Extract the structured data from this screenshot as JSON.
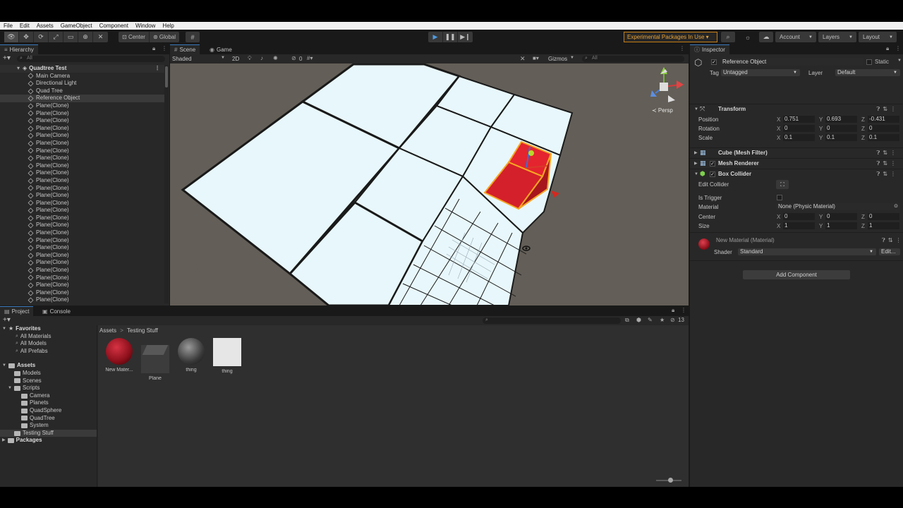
{
  "menu": [
    "File",
    "Edit",
    "Assets",
    "GameObject",
    "Component",
    "Window",
    "Help"
  ],
  "toolbar": {
    "pivot": "Center",
    "space": "Global",
    "experimental": "Experimental Packages In Use ▾",
    "account": "Account",
    "layers": "Layers",
    "layout": "Layout"
  },
  "hierarchy": {
    "tab": "Hierarchy",
    "search_placeholder": "All",
    "root": "Quadtree Test",
    "items": [
      "Main Camera",
      "Directional Light",
      "Quad Tree",
      "Reference Object",
      "Plane(Clone)",
      "Plane(Clone)",
      "Plane(Clone)",
      "Plane(Clone)",
      "Plane(Clone)",
      "Plane(Clone)",
      "Plane(Clone)",
      "Plane(Clone)",
      "Plane(Clone)",
      "Plane(Clone)",
      "Plane(Clone)",
      "Plane(Clone)",
      "Plane(Clone)",
      "Plane(Clone)",
      "Plane(Clone)",
      "Plane(Clone)",
      "Plane(Clone)",
      "Plane(Clone)",
      "Plane(Clone)",
      "Plane(Clone)",
      "Plane(Clone)",
      "Plane(Clone)",
      "Plane(Clone)",
      "Plane(Clone)",
      "Plane(Clone)",
      "Plane(Clone)",
      "Plane(Clone)"
    ],
    "selected_index": 3
  },
  "scene": {
    "tabs": [
      "Scene",
      "Game"
    ],
    "shading": "Shaded",
    "mode_2d": "2D",
    "hidden_count": "0",
    "gizmos": "Gizmos",
    "search_placeholder": "All",
    "projection": "≺ Persp"
  },
  "inspector": {
    "tab": "Inspector",
    "object_name": "Reference Object",
    "static_label": "Static",
    "tag_label": "Tag",
    "tag_value": "Untagged",
    "layer_label": "Layer",
    "layer_value": "Default",
    "transform": {
      "title": "Transform",
      "position_label": "Position",
      "rotation_label": "Rotation",
      "scale_label": "Scale",
      "position": {
        "x": "0.751",
        "y": "0.693",
        "z": "-0.431"
      },
      "rotation": {
        "x": "0",
        "y": "0",
        "z": "0"
      },
      "scale": {
        "x": "0.1",
        "y": "0.1",
        "z": "0.1"
      }
    },
    "mesh_filter": "Cube (Mesh Filter)",
    "mesh_renderer": "Mesh Renderer",
    "box_collider": {
      "title": "Box Collider",
      "edit_collider": "Edit Collider",
      "is_trigger": "Is Trigger",
      "material_label": "Material",
      "material_value": "None (Physic Material)",
      "center_label": "Center",
      "size_label": "Size",
      "center": {
        "x": "0",
        "y": "0",
        "z": "0"
      },
      "size": {
        "x": "1",
        "y": "1",
        "z": "1"
      }
    },
    "material": {
      "title": "New Material (Material)",
      "shader_label": "Shader",
      "shader_value": "Standard",
      "edit_label": "Edit..."
    },
    "add_component": "Add Component"
  },
  "project": {
    "tabs": [
      "Project",
      "Console"
    ],
    "badge_count": "13",
    "favorites": {
      "title": "Favorites",
      "items": [
        "All Materials",
        "All Models",
        "All Prefabs"
      ]
    },
    "assets_title": "Assets",
    "folders": [
      "Models",
      "Scenes",
      "Scripts"
    ],
    "script_folders": [
      "Camera",
      "Planets",
      "QuadSphere",
      "QuadTree",
      "System"
    ],
    "testing_folder": "Testing Stuff",
    "packages": "Packages",
    "breadcrumb_root": "Assets",
    "breadcrumb_sep": ">",
    "breadcrumb_current": "Testing Stuff",
    "assets": [
      {
        "name": "New Mater...",
        "kind": "red-sphere"
      },
      {
        "name": "Plane",
        "kind": "plane"
      },
      {
        "name": "thing",
        "kind": "dark-sphere"
      },
      {
        "name": "thing",
        "kind": "white-square"
      }
    ]
  },
  "colors": {
    "accent_blue": "#3a79bb",
    "selection_orange": "#f5a623",
    "cube_red": "#d4202a",
    "warning_orange": "#c47d13"
  }
}
